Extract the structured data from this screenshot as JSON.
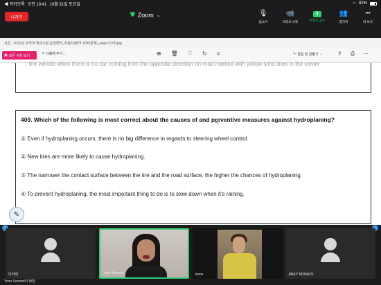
{
  "status": {
    "carrier": "◀ 카카오톡",
    "time": "오전 10:41",
    "date": "10월 31일 토요일",
    "battery": "82%"
  },
  "top_bar": {
    "leave_label": "나가기",
    "app_title": "Zoom",
    "tools": [
      {
        "icon": "🎙",
        "label": "음소거"
      },
      {
        "icon": "📹",
        "label": "비디오 시작"
      },
      {
        "icon": "⬆",
        "label": "콘텐츠 공유"
      },
      {
        "icon": "👥",
        "label": "참가자"
      },
      {
        "icon": "•••",
        "label": "더 보기"
      }
    ]
  },
  "viewer": {
    "doc_title": "사진 - 2020년 외국어 학과시험 운전면허_자동차(영어 1000문제)_page-0109.jpg",
    "original_label": "모든 사진 보기",
    "add_label": "다음에 추가...",
    "edit_label": "편집 및 만들기"
  },
  "document": {
    "prev_text": "... the vehicle when there is no car coming from the opposite direction on road marked with yellow solid lines in the center",
    "question": "409. Which of the following is most correct about the causes of and preventive measures against hydroplaning?",
    "options": [
      "①  Even if hydroplaning occurs, there is no big difference in regards to steering wheel control.",
      "②  New tires are more likely to cause hydroplaning.",
      "③  The narrower the contact surface between the tire and the road surface, the higher the chances of hydroplaning.",
      "④  To prevent hydroplaning, the most important thing to do is to slow down when it's raining."
    ]
  },
  "participants": [
    {
      "name": "미리태",
      "type": "avatar"
    },
    {
      "name": "Yoon Seonmi",
      "type": "video-woman"
    },
    {
      "name": "Irene",
      "type": "video-irene"
    },
    {
      "name": "JINKY NONATO",
      "type": "avatar"
    }
  ],
  "footer_label": "Yoon Seonmi의 화면"
}
